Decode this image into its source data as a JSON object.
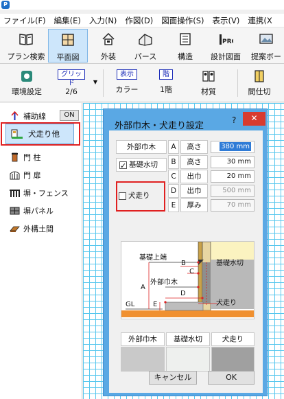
{
  "menubar": {
    "items": [
      "ファイル(F)",
      "編集(E)",
      "入力(N)",
      "作図(D)",
      "図面操作(S)",
      "表示(V)",
      "連携(X"
    ]
  },
  "toolbar1": {
    "buttons": [
      {
        "label": "プラン検索",
        "icon": "book-icon"
      },
      {
        "label": "平面図",
        "icon": "floorplan-icon",
        "active": true
      },
      {
        "label": "外装",
        "icon": "house-exterior-icon"
      },
      {
        "label": "パース",
        "icon": "perspective-house-icon"
      },
      {
        "label": "構造",
        "icon": "structure-icon"
      },
      {
        "label": "設計図面",
        "icon": "pro-drawing-icon"
      },
      {
        "label": "提案ボー",
        "icon": "proposal-board-icon"
      }
    ]
  },
  "toolbar2": {
    "env_label": "環境設定",
    "grid_box": "グリッド",
    "grid_value": "2/6",
    "display_box": "表示",
    "display_value": "カラー",
    "floor_box": "階",
    "floor_value": "1階",
    "material_label": "材質",
    "partition_label": "間仕切"
  },
  "leftpanel": {
    "aux_line": "補助線",
    "aux_state": "ON",
    "selected": "犬走り他",
    "items": [
      "門 柱",
      "門 扉",
      "塀・フェンス",
      "塀パネル",
      "外構土間"
    ]
  },
  "dialog": {
    "title": "外部巾木・犬走り設定",
    "help": "?",
    "close": "✕",
    "header_left": "外部巾木",
    "chk_kiso": "基礎水切",
    "chk_inubashiri": "犬走り",
    "rows": [
      {
        "key": "A",
        "label": "高さ",
        "value": "380 mm",
        "state": "selected"
      },
      {
        "key": "B",
        "label": "高さ",
        "value": "30 mm",
        "state": "normal"
      },
      {
        "key": "C",
        "label": "出巾",
        "value": "20 mm",
        "state": "normal"
      },
      {
        "key": "D",
        "label": "出巾",
        "value": "500 mm",
        "state": "disabled"
      },
      {
        "key": "E",
        "label": "厚み",
        "value": "70 mm",
        "state": "disabled"
      }
    ],
    "diagram": {
      "kiso_top": "基礎上端",
      "kiso_mizukiri": "基礎水切",
      "gaibu_habaki": "外部巾木",
      "inubashiri": "犬走り",
      "gl": "GL",
      "letters": [
        "A",
        "B",
        "C",
        "D",
        "E"
      ]
    },
    "swatch_headers": [
      "外部巾木",
      "基礎水切",
      "犬走り"
    ],
    "swatch_colors": [
      "#c9c9c9",
      "#eef0ee",
      "#a0a0a0"
    ],
    "cancel": "キャンセル",
    "ok": "OK"
  }
}
